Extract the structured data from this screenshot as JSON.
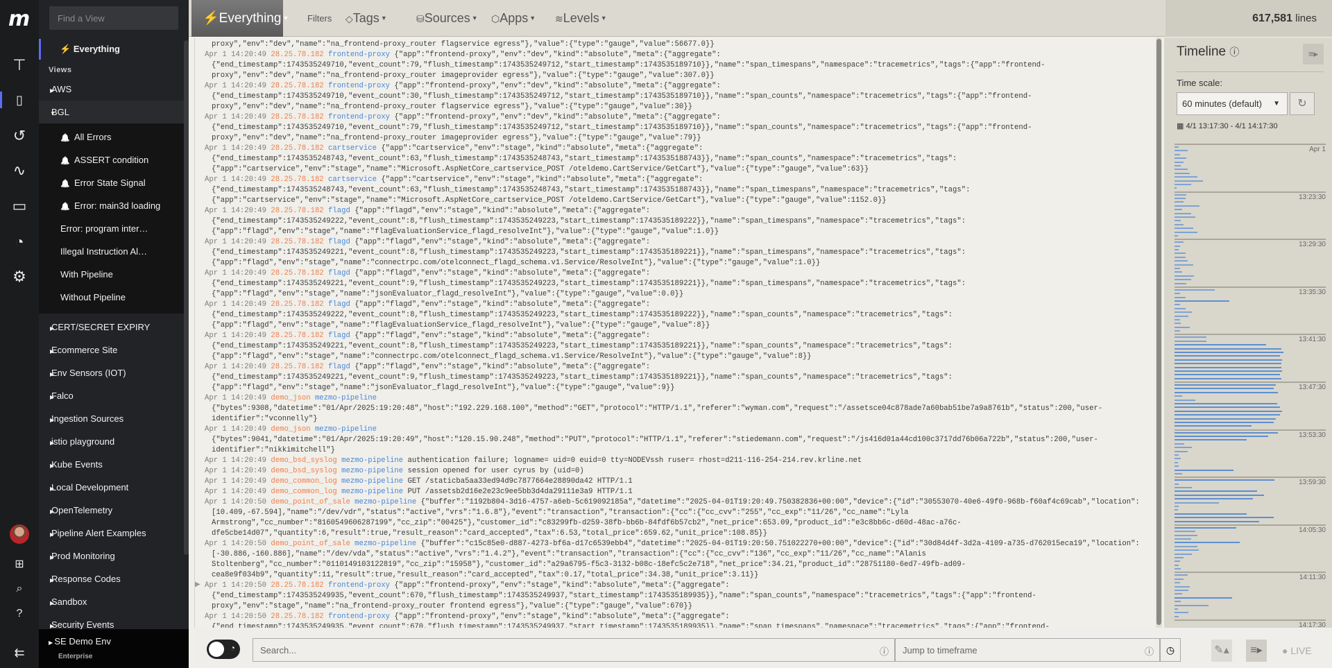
{
  "sidebar": {
    "find_placeholder": "Find a View",
    "everything": "Everything",
    "views_label": "Views",
    "groups_top": [
      {
        "label": "AWS"
      },
      {
        "label": "BGL",
        "expanded": true
      }
    ],
    "bgl_children": [
      {
        "label": "All Errors",
        "alert": true
      },
      {
        "label": "ASSERT condition",
        "alert": true
      },
      {
        "label": "Error State Signal",
        "alert": true
      },
      {
        "label": "Error: main3d loading",
        "alert": true
      },
      {
        "label": "Error: program inter…",
        "alert": false
      },
      {
        "label": "Illegal Instruction Al…",
        "alert": false
      },
      {
        "label": "With Pipeline",
        "alert": false
      },
      {
        "label": "Without Pipeline",
        "alert": false
      }
    ],
    "groups": [
      "CERT/SECRET EXPIRY",
      "Ecommerce Site",
      "Env Sensors (IOT)",
      "Falco",
      "Ingestion Sources",
      "istio playground",
      "Kube Events",
      "Local Development",
      "OpenTelemetry",
      "Pipeline Alert Examples",
      "Prod Monitoring",
      "Response Codes",
      "Sandbox",
      "Security Events"
    ],
    "account": {
      "name": "SE Demo Env",
      "plan": "Enterprise"
    }
  },
  "toolbar": {
    "view": "Everything",
    "filters": "Filters",
    "tags": "Tags",
    "sources": "Sources",
    "apps": "Apps",
    "levels": "Levels",
    "line_count": "617,581",
    "line_unit": "lines"
  },
  "colors": {
    "host": "#f07e4a",
    "app": "#4a86d6",
    "accent": "#5b6cf5"
  },
  "logs": [
    {
      "cont": [
        "proxy\",\"env\":\"dev\",\"name\":\"na_frontend-proxy_router flagservice egress\"},\"value\":{\"type\":\"gauge\",\"value\":56677.0}}"
      ]
    },
    {
      "time": "Apr 1 14:20:49",
      "host": "28.25.78.182",
      "app": "frontend-proxy",
      "text": "{\"app\":\"frontend-proxy\",\"env\":\"dev\",\"kind\":\"absolute\",\"meta\":{\"aggregate\":",
      "cont": [
        "{\"end_timestamp\":1743535249710,\"event_count\":79,\"flush_timestamp\":1743535249712,\"start_timestamp\":1743535189710}},\"name\":\"span_timespans\",\"namespace\":\"tracemetrics\",\"tags\":{\"app\":\"frontend-",
        "proxy\",\"env\":\"dev\",\"name\":\"na_frontend-proxy_router imageprovider egress\"},\"value\":{\"type\":\"gauge\",\"value\":307.0}}"
      ]
    },
    {
      "time": "Apr 1 14:20:49",
      "host": "28.25.78.182",
      "app": "frontend-proxy",
      "text": "{\"app\":\"frontend-proxy\",\"env\":\"dev\",\"kind\":\"absolute\",\"meta\":{\"aggregate\":",
      "cont": [
        "{\"end_timestamp\":1743535249710,\"event_count\":30,\"flush_timestamp\":1743535249712,\"start_timestamp\":1743535189710}},\"name\":\"span_counts\",\"namespace\":\"tracemetrics\",\"tags\":{\"app\":\"frontend-",
        "proxy\",\"env\":\"dev\",\"name\":\"na_frontend-proxy_router flagservice egress\"},\"value\":{\"type\":\"gauge\",\"value\":30}}"
      ]
    },
    {
      "time": "Apr 1 14:20:49",
      "host": "28.25.78.182",
      "app": "frontend-proxy",
      "text": "{\"app\":\"frontend-proxy\",\"env\":\"dev\",\"kind\":\"absolute\",\"meta\":{\"aggregate\":",
      "cont": [
        "{\"end_timestamp\":1743535249710,\"event_count\":79,\"flush_timestamp\":1743535249712,\"start_timestamp\":1743535189710}},\"name\":\"span_counts\",\"namespace\":\"tracemetrics\",\"tags\":{\"app\":\"frontend-",
        "proxy\",\"env\":\"dev\",\"name\":\"na_frontend-proxy_router imageprovider egress\"},\"value\":{\"type\":\"gauge\",\"value\":79}}"
      ]
    },
    {
      "time": "Apr 1 14:20:49",
      "host": "28.25.78.182",
      "app": "cartservice",
      "text": "{\"app\":\"cartservice\",\"env\":\"stage\",\"kind\":\"absolute\",\"meta\":{\"aggregate\":",
      "cont": [
        "{\"end_timestamp\":1743535248743,\"event_count\":63,\"flush_timestamp\":1743535248743,\"start_timestamp\":1743535188743}},\"name\":\"span_counts\",\"namespace\":\"tracemetrics\",\"tags\":",
        "{\"app\":\"cartservice\",\"env\":\"stage\",\"name\":\"Microsoft.AspNetCore_cartservice_POST /oteldemo.CartService/GetCart\"},\"value\":{\"type\":\"gauge\",\"value\":63}}"
      ]
    },
    {
      "time": "Apr 1 14:20:49",
      "host": "28.25.78.182",
      "app": "cartservice",
      "text": "{\"app\":\"cartservice\",\"env\":\"stage\",\"kind\":\"absolute\",\"meta\":{\"aggregate\":",
      "cont": [
        "{\"end_timestamp\":1743535248743,\"event_count\":63,\"flush_timestamp\":1743535248743,\"start_timestamp\":1743535188743}},\"name\":\"span_timespans\",\"namespace\":\"tracemetrics\",\"tags\":",
        "{\"app\":\"cartservice\",\"env\":\"stage\",\"name\":\"Microsoft.AspNetCore_cartservice_POST /oteldemo.CartService/GetCart\"},\"value\":{\"type\":\"gauge\",\"value\":1152.0}}"
      ]
    },
    {
      "time": "Apr 1 14:20:49",
      "host": "28.25.78.182",
      "app": "flagd",
      "text": "{\"app\":\"flagd\",\"env\":\"stage\",\"kind\":\"absolute\",\"meta\":{\"aggregate\":",
      "cont": [
        "{\"end_timestamp\":1743535249222,\"event_count\":8,\"flush_timestamp\":1743535249223,\"start_timestamp\":1743535189222}},\"name\":\"span_timespans\",\"namespace\":\"tracemetrics\",\"tags\":",
        "{\"app\":\"flagd\",\"env\":\"stage\",\"name\":\"flagEvaluationService_flagd_resolveInt\"},\"value\":{\"type\":\"gauge\",\"value\":1.0}}"
      ]
    },
    {
      "time": "Apr 1 14:20:49",
      "host": "28.25.78.182",
      "app": "flagd",
      "text": "{\"app\":\"flagd\",\"env\":\"stage\",\"kind\":\"absolute\",\"meta\":{\"aggregate\":",
      "cont": [
        "{\"end_timestamp\":1743535249221,\"event_count\":8,\"flush_timestamp\":1743535249223,\"start_timestamp\":1743535189221}},\"name\":\"span_timespans\",\"namespace\":\"tracemetrics\",\"tags\":",
        "{\"app\":\"flagd\",\"env\":\"stage\",\"name\":\"connectrpc.com/otelconnect_flagd_schema.v1.Service/ResolveInt\"},\"value\":{\"type\":\"gauge\",\"value\":1.0}}"
      ]
    },
    {
      "time": "Apr 1 14:20:49",
      "host": "28.25.78.182",
      "app": "flagd",
      "text": "{\"app\":\"flagd\",\"env\":\"stage\",\"kind\":\"absolute\",\"meta\":{\"aggregate\":",
      "cont": [
        "{\"end_timestamp\":1743535249221,\"event_count\":9,\"flush_timestamp\":1743535249223,\"start_timestamp\":1743535189221}},\"name\":\"span_timespans\",\"namespace\":\"tracemetrics\",\"tags\":",
        "{\"app\":\"flagd\",\"env\":\"stage\",\"name\":\"jsonEvaluator_flagd_resolveInt\"},\"value\":{\"type\":\"gauge\",\"value\":0.0}}"
      ]
    },
    {
      "time": "Apr 1 14:20:49",
      "host": "28.25.78.182",
      "app": "flagd",
      "text": "{\"app\":\"flagd\",\"env\":\"stage\",\"kind\":\"absolute\",\"meta\":{\"aggregate\":",
      "cont": [
        "{\"end_timestamp\":1743535249222,\"event_count\":8,\"flush_timestamp\":1743535249223,\"start_timestamp\":1743535189222}},\"name\":\"span_counts\",\"namespace\":\"tracemetrics\",\"tags\":",
        "{\"app\":\"flagd\",\"env\":\"stage\",\"name\":\"flagEvaluationService_flagd_resolveInt\"},\"value\":{\"type\":\"gauge\",\"value\":8}}"
      ]
    },
    {
      "time": "Apr 1 14:20:49",
      "host": "28.25.78.182",
      "app": "flagd",
      "text": "{\"app\":\"flagd\",\"env\":\"stage\",\"kind\":\"absolute\",\"meta\":{\"aggregate\":",
      "cont": [
        "{\"end_timestamp\":1743535249221,\"event_count\":8,\"flush_timestamp\":1743535249223,\"start_timestamp\":1743535189221}},\"name\":\"span_counts\",\"namespace\":\"tracemetrics\",\"tags\":",
        "{\"app\":\"flagd\",\"env\":\"stage\",\"name\":\"connectrpc.com/otelconnect_flagd_schema.v1.Service/ResolveInt\"},\"value\":{\"type\":\"gauge\",\"value\":8}}"
      ]
    },
    {
      "time": "Apr 1 14:20:49",
      "host": "28.25.78.182",
      "app": "flagd",
      "text": "{\"app\":\"flagd\",\"env\":\"stage\",\"kind\":\"absolute\",\"meta\":{\"aggregate\":",
      "cont": [
        "{\"end_timestamp\":1743535249221,\"event_count\":9,\"flush_timestamp\":1743535249223,\"start_timestamp\":1743535189221}},\"name\":\"span_counts\",\"namespace\":\"tracemetrics\",\"tags\":",
        "{\"app\":\"flagd\",\"env\":\"stage\",\"name\":\"jsonEvaluator_flagd_resolveInt\"},\"value\":{\"type\":\"gauge\",\"value\":9}}"
      ]
    },
    {
      "time": "Apr 1 14:20:49",
      "host": "demo_json",
      "app": "mezmo-pipeline",
      "text": "",
      "cont": [
        "{\"bytes\":9308,\"datetime\":\"01/Apr/2025:19:20:48\",\"host\":\"192.229.168.100\",\"method\":\"GET\",\"protocol\":\"HTTP/1.1\",\"referer\":\"wyman.com\",\"request\":\"/assetsce04c878ade7a60bab51be7a9a8761b\",\"status\":200,\"user-",
        "identifier\":\"vconnelly\"}"
      ]
    },
    {
      "time": "Apr 1 14:20:49",
      "host": "demo_json",
      "app": "mezmo-pipeline",
      "text": "",
      "cont": [
        "{\"bytes\":9041,\"datetime\":\"01/Apr/2025:19:20:49\",\"host\":\"120.15.90.248\",\"method\":\"PUT\",\"protocol\":\"HTTP/1.1\",\"referer\":\"stiedemann.com\",\"request\":\"/js416d01a44cd100c3717dd76b06a722b\",\"status\":200,\"user-",
        "identifier\":\"nikkimitchell\"}"
      ]
    },
    {
      "time": "Apr 1 14:20:49",
      "host": "demo_bsd_syslog",
      "app": "mezmo-pipeline",
      "text": "authentication failure; logname= uid=0 euid=0 tty=NODEVssh ruser= rhost=d211-116-254-214.rev.krline.net",
      "cont": []
    },
    {
      "time": "Apr 1 14:20:49",
      "host": "demo_bsd_syslog",
      "app": "mezmo-pipeline",
      "text": "session opened for user cyrus by (uid=0)",
      "cont": []
    },
    {
      "time": "Apr 1 14:20:49",
      "host": "demo_common_log",
      "app": "mezmo-pipeline",
      "text": "GET /staticba5aa33ed94d9c7877664e28890da42 HTTP/1.1",
      "cont": []
    },
    {
      "time": "Apr 1 14:20:49",
      "host": "demo_common_log",
      "app": "mezmo-pipeline",
      "text": "PUT /assetsb2d16e2e23c9ee5bb3d4da29111e3a9 HTTP/1.1",
      "cont": []
    },
    {
      "time": "Apr 1 14:20:50",
      "host": "demo_point_of_sale",
      "app": "mezmo-pipeline",
      "text": "{\"buffer\":\"1192b804-3d16-4757-a6eb-5c619092185a\",\"datetime\":\"2025-04-01T19:20:49.750382836+00:00\",\"device\":{\"id\":\"30553070-40e6-49f0-968b-f60af4c69cab\",\"location\":",
      "cont": [
        "[10.409,-67.594],\"name\":\"/dev/vdr\",\"status\":\"active\",\"vrs\":\"1.6.8\"},\"event\":\"transaction\",\"transaction\":{\"cc\":{\"cc_cvv\":\"255\",\"cc_exp\":\"11/26\",\"cc_name\":\"Lyla",
        "Armstrong\",\"cc_number\":\"8160549606287199\",\"cc_zip\":\"00425\"},\"customer_id\":\"c83299fb-d259-38fb-bb6b-84fdf6b57cb2\",\"net_price\":653.09,\"product_id\":\"e3c8bb6c-d60d-48ac-a76c-",
        "dfe5cbe14d07\",\"quantity\":6,\"result\":true,\"result_reason\":\"card_accepted\",\"tax\":6.53,\"total_price\":659.62,\"unit_price\":108.85}}"
      ]
    },
    {
      "time": "Apr 1 14:20:50",
      "host": "demo_point_of_sale",
      "app": "mezmo-pipeline",
      "text": "{\"buffer\":\"c15c85e0-d887-4273-bf6a-d17c6539ebb4\",\"datetime\":\"2025-04-01T19:20:50.751022270+00:00\",\"device\":{\"id\":\"30d84d4f-3d2a-4109-a735-d762015eca19\",\"location\":",
      "cont": [
        "[-30.886,-160.886],\"name\":\"/dev/vda\",\"status\":\"active\",\"vrs\":\"1.4.2\"},\"event\":\"transaction\",\"transaction\":{\"cc\":{\"cc_cvv\":\"136\",\"cc_exp\":\"11/26\",\"cc_name\":\"Alanis",
        "Stoltenberg\",\"cc_number\":\"0110149103122819\",\"cc_zip\":\"15958\"},\"customer_id\":\"a29a6795-f5c3-3132-b08c-18efc5c2e718\",\"net_price\":34.21,\"product_id\":\"28751180-6ed7-49fb-ad09-",
        "cea8e9f034b9\",\"quantity\":11,\"result\":true,\"result_reason\":\"card_accepted\",\"tax\":0.17,\"total_price\":34.38,\"unit_price\":3.11}}"
      ]
    },
    {
      "time": "Apr 1 14:20:50",
      "host": "28.25.78.182",
      "app": "frontend-proxy",
      "text": "{\"app\":\"frontend-proxy\",\"env\":\"stage\",\"kind\":\"absolute\",\"meta\":{\"aggregate\":",
      "cont": [
        "{\"end_timestamp\":1743535249935,\"event_count\":670,\"flush_timestamp\":1743535249937,\"start_timestamp\":1743535189935}},\"name\":\"span_counts\",\"namespace\":\"tracemetrics\",\"tags\":{\"app\":\"frontend-",
        "proxy\",\"env\":\"stage\",\"name\":\"na_frontend-proxy_router frontend egress\"},\"value\":{\"type\":\"gauge\",\"value\":670}}"
      ]
    },
    {
      "time": "Apr 1 14:20:50",
      "host": "28.25.78.182",
      "app": "frontend-proxy",
      "text": "{\"app\":\"frontend-proxy\",\"env\":\"stage\",\"kind\":\"absolute\",\"meta\":{\"aggregate\":",
      "cont": [
        "{\"end_timestamp\":1743535249935,\"event_count\":670,\"flush_timestamp\":1743535249937,\"start_timestamp\":1743535189935}},\"name\":\"span_timespans\",\"namespace\":\"tracemetrics\",\"tags\":{\"app\":\"frontend-"
      ]
    }
  ],
  "timeline": {
    "title": "Timeline",
    "time_scale_label": "Time scale:",
    "time_scale_value": "60 minutes (default)",
    "range": "4/1 13:17:30 - 4/1 14:17:30",
    "labels": [
      "Apr 1",
      "13:23:30",
      "13:29:30",
      "13:35:30",
      "13:41:30",
      "13:47:30",
      "13:53:30",
      "13:59:30",
      "14:05:30",
      "14:11:30",
      "14:17:30"
    ],
    "histogram_relative": [
      [
        4,
        12,
        5,
        11,
        8,
        6,
        12,
        14,
        21,
        26,
        15,
        2
      ],
      [
        11,
        10,
        8,
        23,
        7,
        15,
        19,
        6,
        8,
        17,
        21,
        3
      ],
      [
        8,
        5,
        4,
        10,
        10,
        12,
        17,
        5,
        7,
        18,
        15,
        11
      ],
      [
        37,
        5,
        10,
        50,
        5,
        10,
        16,
        13,
        5,
        6,
        14,
        5
      ],
      [
        29,
        29,
        84,
        98,
        100,
        97,
        99,
        98,
        98,
        99,
        97,
        98
      ],
      [
        93,
        91,
        95,
        7,
        19,
        94,
        97,
        99,
        97,
        93,
        91,
        71
      ],
      [
        95,
        86,
        66,
        9,
        16,
        12,
        4,
        6,
        3,
        4,
        54,
        7
      ],
      [
        92,
        4,
        16,
        76,
        82,
        72,
        41,
        4,
        3,
        66,
        91,
        78
      ],
      [
        57,
        19,
        21,
        15,
        60,
        21,
        22,
        16,
        8,
        5,
        4,
        6
      ],
      [
        12,
        8,
        5,
        14,
        13,
        7,
        53,
        6,
        31,
        3,
        13,
        4
      ]
    ]
  },
  "bottom": {
    "search_placeholder": "Search...",
    "jump_placeholder": "Jump to timeframe",
    "live": "LIVE"
  }
}
